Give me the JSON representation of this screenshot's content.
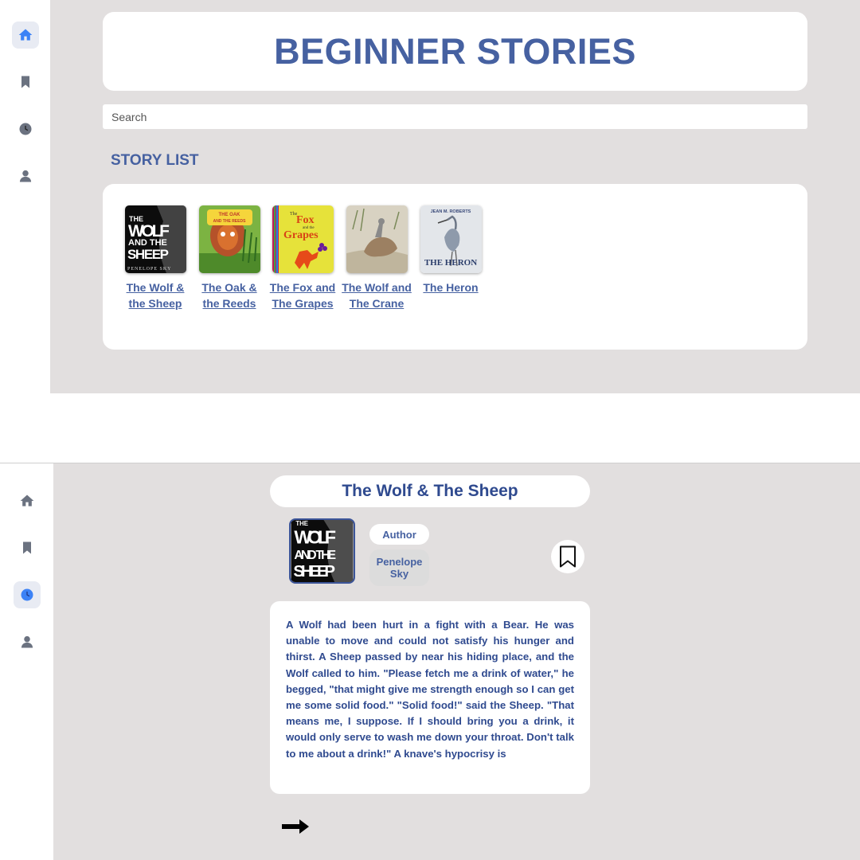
{
  "home": {
    "title": "BEGINNER STORIES",
    "search": {
      "placeholder": "Search"
    },
    "section_title": "STORY LIST",
    "stories": [
      {
        "label": "The Wolf & the Sheep",
        "cover": "wolf-sheep",
        "cover_text": [
          "THE",
          "WOLF",
          "AND THE",
          "SHEEP",
          "PENELOPE SKY"
        ]
      },
      {
        "label": "The Oak & the Reeds",
        "cover": "oak-reeds",
        "cover_text": [
          "THE OAK",
          "AND THE REEDS"
        ]
      },
      {
        "label": "The Fox and The Grapes",
        "cover": "fox-grapes",
        "cover_text": [
          "The",
          "Fox",
          "and the",
          "Grapes"
        ]
      },
      {
        "label": "The Wolf and The Crane",
        "cover": "wolf-crane",
        "cover_text": []
      },
      {
        "label": "The Heron",
        "cover": "heron",
        "cover_text": [
          "JEAN M. ROBERTS",
          "THE HERON"
        ]
      }
    ]
  },
  "sidebar": {
    "items": [
      "home-icon",
      "bookmark-icon",
      "history-icon",
      "profile-icon"
    ],
    "active_screen1": "home-icon",
    "active_screen2": "history-icon",
    "active_color": "#3b82f6",
    "inactive_color": "#6b7280"
  },
  "detail": {
    "title": "The Wolf & The Sheep",
    "cover_text": [
      "THE",
      "WOLF",
      "AND THE",
      "SHEEP"
    ],
    "author_label": "Author",
    "author_name": "Penelope Sky",
    "text": "A Wolf had been hurt in a fight with a Bear. He was unable to move and could not satisfy his hunger and thirst. A Sheep passed by near his hiding place, and the Wolf called to him. \"Please fetch me a drink of water,\" he begged, \"that might give me strength enough so I can get me some solid food.\" \"Solid food!\" said the Sheep. \"That means me, I suppose. If I should bring you a drink, it would only serve to wash me down your throat. Don't talk to me about a drink!\" A knave's hypocrisy is",
    "next_icon": "arrow-right-icon"
  },
  "colors": {
    "accent": "#4661a1",
    "panel_bg": "#e2dfdf",
    "card_bg": "#ffffff"
  }
}
